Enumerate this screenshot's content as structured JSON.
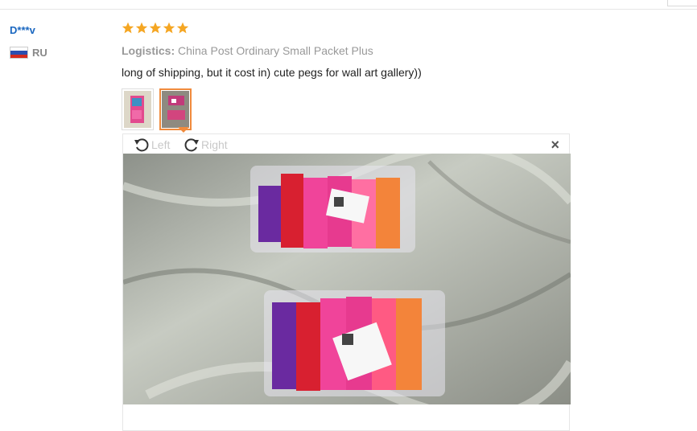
{
  "review": {
    "user_name": "D***v",
    "country_code": "RU",
    "rating": 5,
    "logistics_label": "Logistics:",
    "logistics_value": "China Post Ordinary Small Packet Plus",
    "comment": "long of shipping, but it cost in) cute pegs for wall art gallery))"
  },
  "viewer": {
    "rotate_left_label": "Left",
    "rotate_right_label": "Right",
    "close_glyph": "×"
  },
  "colors": {
    "star": "#f5a623",
    "thumb_active_border": "#f08a3c",
    "user_name": "#1a67c0"
  },
  "icons": [
    "star-icon",
    "rotate-left-icon",
    "rotate-right-icon",
    "close-icon",
    "flag-ru-icon"
  ]
}
